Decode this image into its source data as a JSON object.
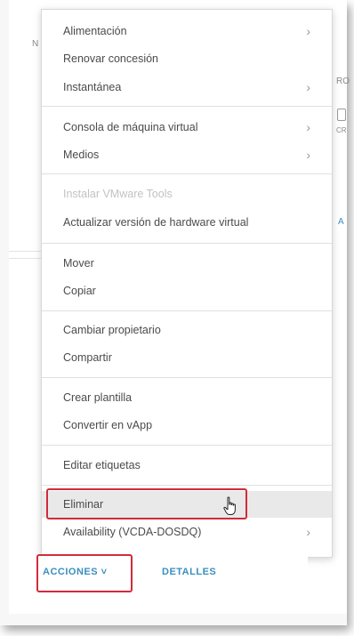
{
  "menu": {
    "items": [
      {
        "label": "Alimentación",
        "submenu": true,
        "enabled": true
      },
      {
        "label": "Renovar concesión",
        "submenu": false,
        "enabled": true
      },
      {
        "label": "Instantánea",
        "submenu": true,
        "enabled": true
      },
      {
        "label": "Consola de máquina virtual",
        "submenu": true,
        "enabled": true
      },
      {
        "label": "Medios",
        "submenu": true,
        "enabled": true
      },
      {
        "label": "Instalar VMware Tools",
        "submenu": false,
        "enabled": false
      },
      {
        "label": "Actualizar versión de hardware virtual",
        "submenu": false,
        "enabled": true
      },
      {
        "label": "Mover",
        "submenu": false,
        "enabled": true
      },
      {
        "label": "Copiar",
        "submenu": false,
        "enabled": true
      },
      {
        "label": "Cambiar propietario",
        "submenu": false,
        "enabled": true
      },
      {
        "label": "Compartir",
        "submenu": false,
        "enabled": true
      },
      {
        "label": "Crear plantilla",
        "submenu": false,
        "enabled": true
      },
      {
        "label": "Convertir en vApp",
        "submenu": false,
        "enabled": true
      },
      {
        "label": "Editar etiquetas",
        "submenu": false,
        "enabled": true
      },
      {
        "label": "Eliminar",
        "submenu": false,
        "enabled": true,
        "hovered": true
      },
      {
        "label": "Availability (VCDA-DOSDQ)",
        "submenu": true,
        "enabled": true
      }
    ],
    "chevron": "›"
  },
  "footer": {
    "actions_label": "ACCIONES ˅",
    "details_label": "DETALLES"
  },
  "background": {
    "fragment_n": "N",
    "fragment_ro": "RO",
    "fragment_cr": "CR",
    "fragment_a": "A"
  },
  "colors": {
    "accent": "#3a8fbf",
    "highlight": "#d22b3a",
    "disabled_text": "#c2c2c2"
  },
  "icons": {
    "cursor": "hand-pointer-icon",
    "submenu": "chevron-right-icon"
  }
}
